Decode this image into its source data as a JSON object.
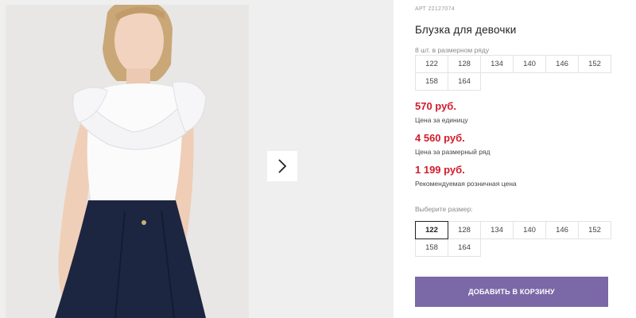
{
  "product": {
    "sku": "АРТ 22127074",
    "title": "Блузка для девочки"
  },
  "pack": {
    "label": "8 шт. в размерном ряду",
    "sizes": [
      "122",
      "128",
      "134",
      "140",
      "146",
      "152",
      "158",
      "164"
    ]
  },
  "prices": [
    {
      "value": "570 руб.",
      "note": "Цена за единицу"
    },
    {
      "value": "4 560 руб.",
      "note": "Цена за размерный ряд"
    },
    {
      "value": "1 199 руб.",
      "note": "Рекомендуемая розничная цена"
    }
  ],
  "size_picker": {
    "label": "Выберите размер:",
    "sizes": [
      "122",
      "128",
      "134",
      "140",
      "146",
      "152",
      "158",
      "164"
    ],
    "selected": "122"
  },
  "cart": {
    "button_label": "ДОБАВИТЬ В КОРЗИНУ"
  },
  "colors": {
    "price": "#d21c2d",
    "cart_button": "#7b68a6"
  },
  "icons": {
    "next": "chevron-right-icon"
  }
}
